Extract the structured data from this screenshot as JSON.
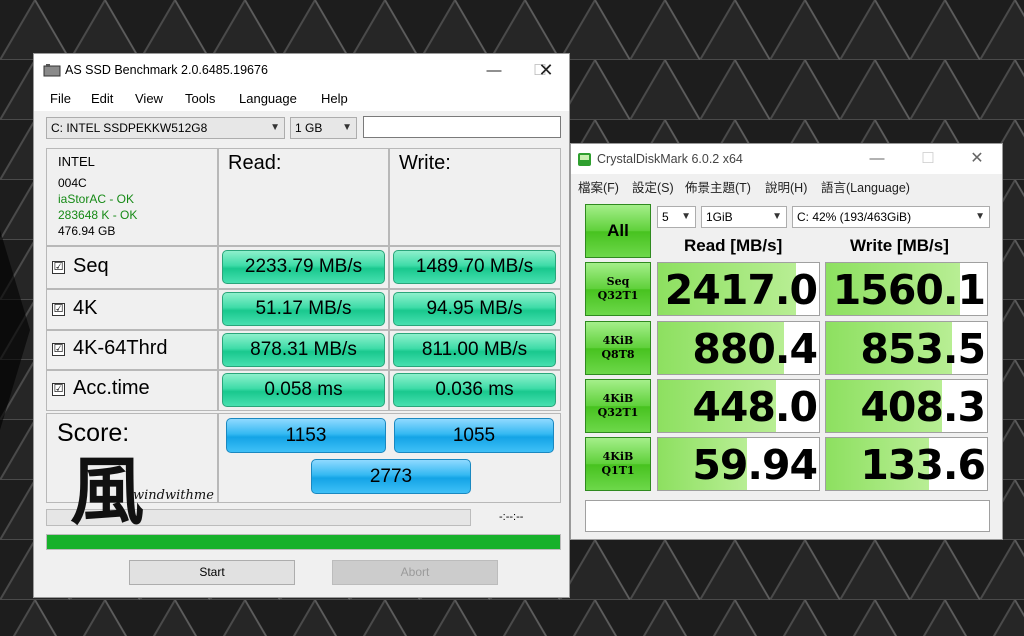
{
  "as_ssd": {
    "title": "AS SSD Benchmark 2.0.6485.19676",
    "menu": [
      "File",
      "Edit",
      "View",
      "Tools",
      "Language",
      "Help"
    ],
    "drive_select": "C: INTEL SSDPEKKW512G8",
    "size_select": "1 GB",
    "drive_info": {
      "vendor": "INTEL",
      "firmware": "004C",
      "driver": "iaStorAC - OK",
      "alignment": "283648 K - OK",
      "capacity": "476.94 GB"
    },
    "read_header": "Read:",
    "write_header": "Write:",
    "tests": [
      {
        "label": "Seq",
        "read": "2233.79 MB/s",
        "write": "1489.70 MB/s"
      },
      {
        "label": "4K",
        "read": "51.17 MB/s",
        "write": "94.95 MB/s"
      },
      {
        "label": "4K-64Thrd",
        "read": "878.31 MB/s",
        "write": "811.00 MB/s"
      },
      {
        "label": "Acc.time",
        "read": "0.058 ms",
        "write": "0.036 ms"
      }
    ],
    "score_label": "Score:",
    "score_read": "1153",
    "score_write": "1055",
    "score_total": "2773",
    "progress_time": "-:--:--",
    "progress_fraction": 1.0,
    "start_label": "Start",
    "abort_label": "Abort",
    "checkmark": "☑"
  },
  "cdm": {
    "title": "CrystalDiskMark 6.0.2 x64",
    "menu": [
      "檔案(F)",
      "設定(S)",
      "佈景主題(T)",
      "說明(H)",
      "語言(Language)"
    ],
    "all_label": "All",
    "count_select": "5",
    "size_select": "1GiB",
    "drive_select": "C: 42% (193/463GiB)",
    "read_header": "Read [MB/s]",
    "write_header": "Write [MB/s]",
    "rows": [
      {
        "l1": "Seq",
        "l2": "Q32T1",
        "read": "2417.0",
        "write": "1560.1",
        "read_fill": 0.86,
        "write_fill": 0.83
      },
      {
        "l1": "4KiB",
        "l2": "Q8T8",
        "read": "880.4",
        "write": "853.5",
        "read_fill": 0.78,
        "write_fill": 0.78
      },
      {
        "l1": "4KiB",
        "l2": "Q32T1",
        "read": "448.0",
        "write": "408.3",
        "read_fill": 0.73,
        "write_fill": 0.72
      },
      {
        "l1": "4KiB",
        "l2": "Q1T1",
        "read": "59.94",
        "write": "133.6",
        "read_fill": 0.55,
        "write_fill": 0.64
      }
    ]
  },
  "watermark": {
    "char": "風",
    "text": "windwithme"
  },
  "colors": {
    "green_value": "#3fdca8",
    "blue_score": "#35b9f2",
    "cdm_green": "#5fd03a",
    "progress": "#17b12b"
  }
}
